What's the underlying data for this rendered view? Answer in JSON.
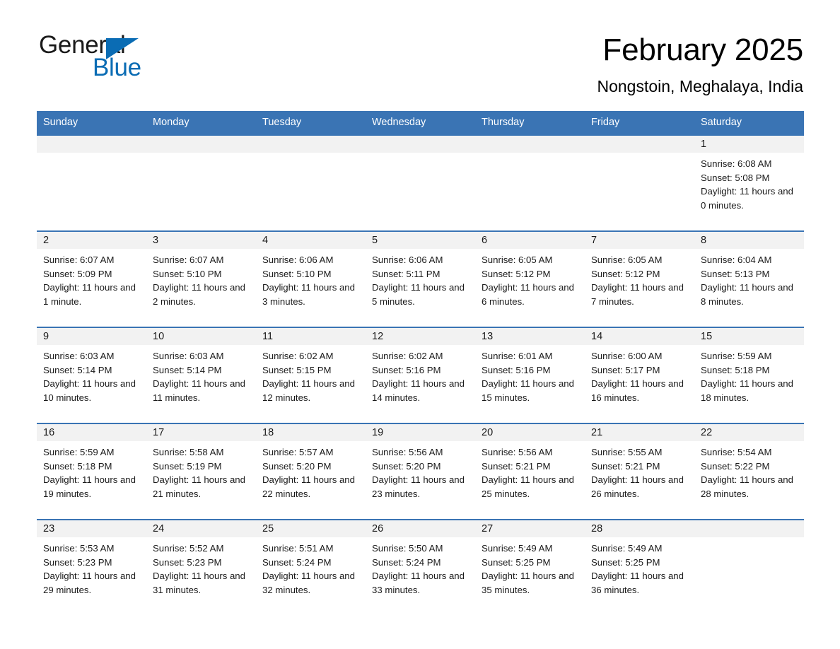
{
  "brand": {
    "word1": "General",
    "word2": "Blue",
    "triangle_color": "#0a6cb4"
  },
  "header": {
    "month_title": "February 2025",
    "location": "Nongstoin, Meghalaya, India"
  },
  "theme": {
    "header_blue": "#3a74b4",
    "day_band_gray": "#f2f2f2",
    "text_color": "#1a1a1a"
  },
  "weekdays": [
    "Sunday",
    "Monday",
    "Tuesday",
    "Wednesday",
    "Thursday",
    "Friday",
    "Saturday"
  ],
  "weeks": [
    [
      {
        "day": ""
      },
      {
        "day": ""
      },
      {
        "day": ""
      },
      {
        "day": ""
      },
      {
        "day": ""
      },
      {
        "day": ""
      },
      {
        "day": "1",
        "sunrise": "Sunrise: 6:08 AM",
        "sunset": "Sunset: 5:08 PM",
        "daylight": "Daylight: 11 hours and 0 minutes."
      }
    ],
    [
      {
        "day": "2",
        "sunrise": "Sunrise: 6:07 AM",
        "sunset": "Sunset: 5:09 PM",
        "daylight": "Daylight: 11 hours and 1 minute."
      },
      {
        "day": "3",
        "sunrise": "Sunrise: 6:07 AM",
        "sunset": "Sunset: 5:10 PM",
        "daylight": "Daylight: 11 hours and 2 minutes."
      },
      {
        "day": "4",
        "sunrise": "Sunrise: 6:06 AM",
        "sunset": "Sunset: 5:10 PM",
        "daylight": "Daylight: 11 hours and 3 minutes."
      },
      {
        "day": "5",
        "sunrise": "Sunrise: 6:06 AM",
        "sunset": "Sunset: 5:11 PM",
        "daylight": "Daylight: 11 hours and 5 minutes."
      },
      {
        "day": "6",
        "sunrise": "Sunrise: 6:05 AM",
        "sunset": "Sunset: 5:12 PM",
        "daylight": "Daylight: 11 hours and 6 minutes."
      },
      {
        "day": "7",
        "sunrise": "Sunrise: 6:05 AM",
        "sunset": "Sunset: 5:12 PM",
        "daylight": "Daylight: 11 hours and 7 minutes."
      },
      {
        "day": "8",
        "sunrise": "Sunrise: 6:04 AM",
        "sunset": "Sunset: 5:13 PM",
        "daylight": "Daylight: 11 hours and 8 minutes."
      }
    ],
    [
      {
        "day": "9",
        "sunrise": "Sunrise: 6:03 AM",
        "sunset": "Sunset: 5:14 PM",
        "daylight": "Daylight: 11 hours and 10 minutes."
      },
      {
        "day": "10",
        "sunrise": "Sunrise: 6:03 AM",
        "sunset": "Sunset: 5:14 PM",
        "daylight": "Daylight: 11 hours and 11 minutes."
      },
      {
        "day": "11",
        "sunrise": "Sunrise: 6:02 AM",
        "sunset": "Sunset: 5:15 PM",
        "daylight": "Daylight: 11 hours and 12 minutes."
      },
      {
        "day": "12",
        "sunrise": "Sunrise: 6:02 AM",
        "sunset": "Sunset: 5:16 PM",
        "daylight": "Daylight: 11 hours and 14 minutes."
      },
      {
        "day": "13",
        "sunrise": "Sunrise: 6:01 AM",
        "sunset": "Sunset: 5:16 PM",
        "daylight": "Daylight: 11 hours and 15 minutes."
      },
      {
        "day": "14",
        "sunrise": "Sunrise: 6:00 AM",
        "sunset": "Sunset: 5:17 PM",
        "daylight": "Daylight: 11 hours and 16 minutes."
      },
      {
        "day": "15",
        "sunrise": "Sunrise: 5:59 AM",
        "sunset": "Sunset: 5:18 PM",
        "daylight": "Daylight: 11 hours and 18 minutes."
      }
    ],
    [
      {
        "day": "16",
        "sunrise": "Sunrise: 5:59 AM",
        "sunset": "Sunset: 5:18 PM",
        "daylight": "Daylight: 11 hours and 19 minutes."
      },
      {
        "day": "17",
        "sunrise": "Sunrise: 5:58 AM",
        "sunset": "Sunset: 5:19 PM",
        "daylight": "Daylight: 11 hours and 21 minutes."
      },
      {
        "day": "18",
        "sunrise": "Sunrise: 5:57 AM",
        "sunset": "Sunset: 5:20 PM",
        "daylight": "Daylight: 11 hours and 22 minutes."
      },
      {
        "day": "19",
        "sunrise": "Sunrise: 5:56 AM",
        "sunset": "Sunset: 5:20 PM",
        "daylight": "Daylight: 11 hours and 23 minutes."
      },
      {
        "day": "20",
        "sunrise": "Sunrise: 5:56 AM",
        "sunset": "Sunset: 5:21 PM",
        "daylight": "Daylight: 11 hours and 25 minutes."
      },
      {
        "day": "21",
        "sunrise": "Sunrise: 5:55 AM",
        "sunset": "Sunset: 5:21 PM",
        "daylight": "Daylight: 11 hours and 26 minutes."
      },
      {
        "day": "22",
        "sunrise": "Sunrise: 5:54 AM",
        "sunset": "Sunset: 5:22 PM",
        "daylight": "Daylight: 11 hours and 28 minutes."
      }
    ],
    [
      {
        "day": "23",
        "sunrise": "Sunrise: 5:53 AM",
        "sunset": "Sunset: 5:23 PM",
        "daylight": "Daylight: 11 hours and 29 minutes."
      },
      {
        "day": "24",
        "sunrise": "Sunrise: 5:52 AM",
        "sunset": "Sunset: 5:23 PM",
        "daylight": "Daylight: 11 hours and 31 minutes."
      },
      {
        "day": "25",
        "sunrise": "Sunrise: 5:51 AM",
        "sunset": "Sunset: 5:24 PM",
        "daylight": "Daylight: 11 hours and 32 minutes."
      },
      {
        "day": "26",
        "sunrise": "Sunrise: 5:50 AM",
        "sunset": "Sunset: 5:24 PM",
        "daylight": "Daylight: 11 hours and 33 minutes."
      },
      {
        "day": "27",
        "sunrise": "Sunrise: 5:49 AM",
        "sunset": "Sunset: 5:25 PM",
        "daylight": "Daylight: 11 hours and 35 minutes."
      },
      {
        "day": "28",
        "sunrise": "Sunrise: 5:49 AM",
        "sunset": "Sunset: 5:25 PM",
        "daylight": "Daylight: 11 hours and 36 minutes."
      },
      {
        "day": ""
      }
    ]
  ]
}
